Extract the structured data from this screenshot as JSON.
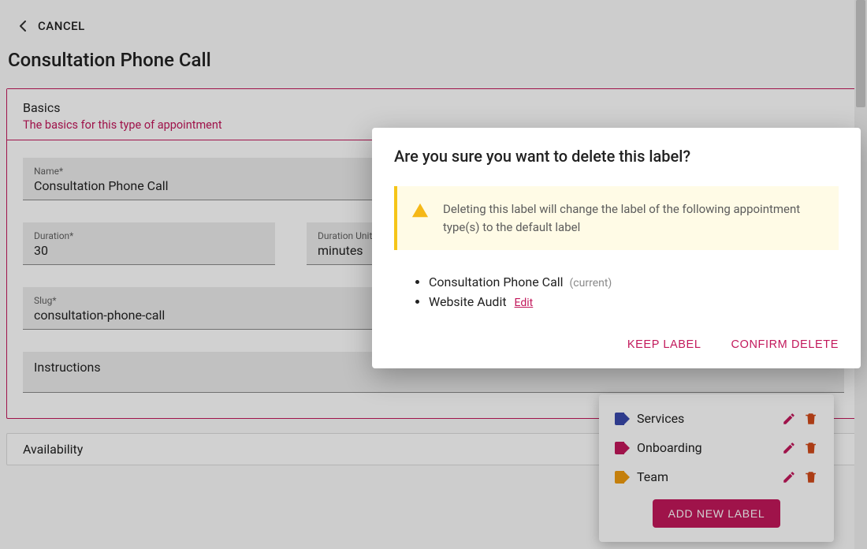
{
  "header": {
    "cancel": "CANCEL",
    "page_title": "Consultation Phone Call"
  },
  "sections": {
    "basics": {
      "title": "Basics",
      "subtitle": "The basics for this type of appointment",
      "name_label": "Name*",
      "name_value": "Consultation Phone Call",
      "duration_label": "Duration*",
      "duration_value": "30",
      "duration_unit_label": "Duration Unit",
      "duration_unit_value": "minutes",
      "slug_label": "Slug*",
      "slug_value": "consultation-phone-call",
      "instructions_label": "Instructions"
    },
    "availability": {
      "title": "Availability"
    }
  },
  "labels_panel": {
    "items": [
      {
        "name": "Services",
        "color": "#3949ab"
      },
      {
        "name": "Onboarding",
        "color": "#c2185b"
      },
      {
        "name": "Team",
        "color": "#ef9c0f"
      }
    ],
    "add_button": "ADD NEW LABEL"
  },
  "dialog": {
    "title": "Are you sure you want to delete this label?",
    "warning": "Deleting this label will change the label of the following appointment type(s) to the default label",
    "affected": [
      {
        "name": "Consultation Phone Call",
        "current": true
      },
      {
        "name": "Website Audit",
        "editable": true
      }
    ],
    "current_tag": "(current)",
    "edit_link": "Edit",
    "keep": "KEEP LABEL",
    "confirm": "CONFIRM DELETE"
  }
}
